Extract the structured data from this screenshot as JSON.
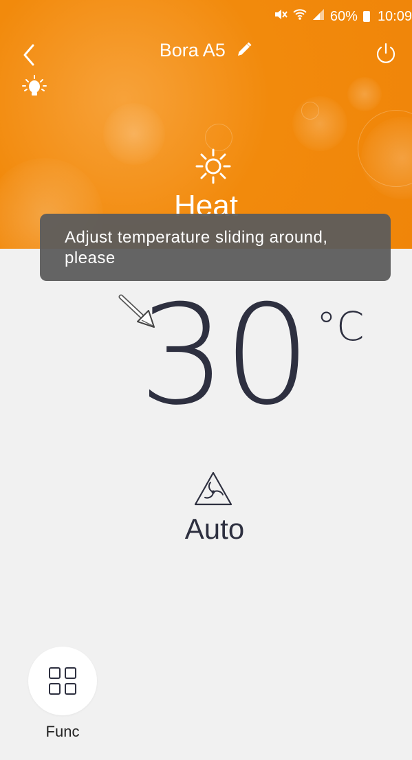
{
  "status_bar": {
    "battery_percent": "60%",
    "time": "10:09"
  },
  "header": {
    "device_name": "Bora A5"
  },
  "mode": {
    "label": "Heat",
    "icon": "sun-icon"
  },
  "toast": {
    "message": "Adjust temperature sliding around, please"
  },
  "temperature": {
    "value": "30",
    "unit": "°C"
  },
  "fan": {
    "label": "Auto",
    "icon": "fan-icon"
  },
  "func_button": {
    "label": "Func",
    "icon": "grid-icon"
  },
  "colors": {
    "accent": "#f28a0c",
    "background": "#f1f1f1",
    "text_dark": "#2e3040",
    "toast_bg": "#5c5c5c"
  }
}
